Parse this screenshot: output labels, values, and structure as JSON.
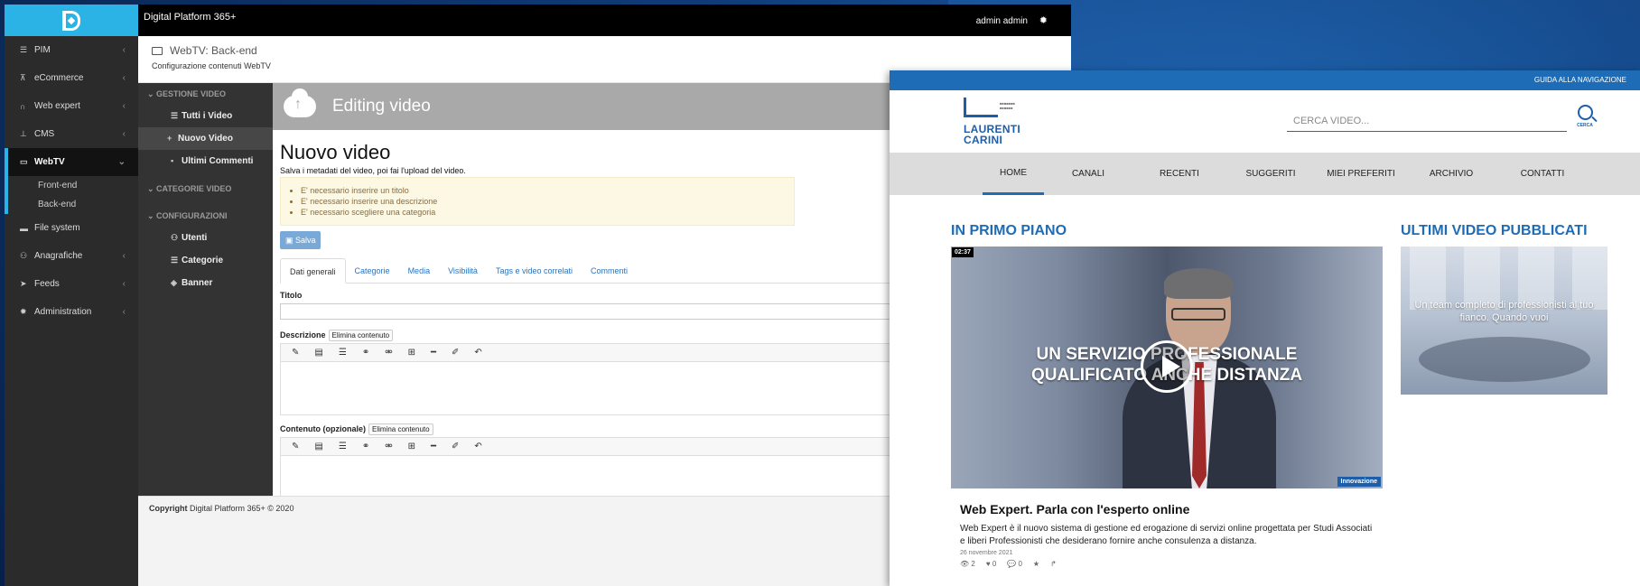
{
  "admin": {
    "app_title": "Digital Platform 365+",
    "user": "admin admin",
    "sidebar": [
      {
        "icon": "list-icon",
        "label": "PIM"
      },
      {
        "icon": "cart-icon",
        "label": "eCommerce"
      },
      {
        "icon": "headset-icon",
        "label": "Web expert"
      },
      {
        "icon": "sitemap-icon",
        "label": "CMS"
      },
      {
        "icon": "monitor-icon",
        "label": "WebTV"
      },
      {
        "icon": "folder-icon",
        "label": "File system"
      },
      {
        "icon": "users-icon",
        "label": "Anagrafiche"
      },
      {
        "icon": "paper-plane-icon",
        "label": "Feeds"
      },
      {
        "icon": "gear-icon",
        "label": "Administration"
      }
    ],
    "webtv_sub": [
      "Front-end",
      "Back-end"
    ],
    "header_title": "WebTV: Back-end",
    "header_sub": "Configurazione contenuti WebTV",
    "sub_menu": {
      "group1": "GESTIONE VIDEO",
      "links1": [
        "Tutti i Video",
        "Nuovo Video",
        "Ultimi Commenti"
      ],
      "group2": "CATEGORIE VIDEO",
      "group3": "CONFIGURAZIONI",
      "links3": [
        "Utenti",
        "Categorie",
        "Banner"
      ]
    },
    "editing_title": "Editing video",
    "page_title": "Nuovo video",
    "hint": "Salva i metadati del video, poi fai l'upload del video.",
    "alerts": [
      "E' necessario inserire un titolo",
      "E' necessario inserire una descrizione",
      "E' necessario scegliere una categoria"
    ],
    "save_label": "Salva",
    "tabs": [
      "Dati generali",
      "Categorie",
      "Media",
      "Visibilità",
      "Tags e video correlati",
      "Commenti"
    ],
    "field_title": "Titolo",
    "field_desc": "Descrizione",
    "field_content": "Contenuto (opzionale)",
    "clear_label": "Elimina contenuto",
    "footer_bold": "Copyright",
    "footer_text": " Digital Platform 365+ © 2020"
  },
  "webtv": {
    "top_link": "GUIDA ALLA NAVIGAZIONE",
    "logo_line1": "LAURENTI",
    "logo_line2": "CARINI",
    "search_placeholder": "CERCA VIDEO...",
    "search_btn": "CERCA",
    "nav": [
      "HOME",
      "CANALI",
      "RECENTI",
      "SUGGERITI",
      "MIEI PREFERITI",
      "ARCHIVIO",
      "CONTATTI"
    ],
    "featured_title": "IN PRIMO PIANO",
    "latest_title": "ULTIMI VIDEO PUBBLICATI",
    "hero": {
      "duration": "02:37",
      "line1": "UN SERVIZIO PROFESSIONALE",
      "line2": "QUALIFICATO ANCHE DISTANZA",
      "badge": "Innovazione"
    },
    "article": {
      "title": "Web Expert. Parla con l'esperto online",
      "desc": "Web Expert è il nuovo sistema di gestione ed erogazione di servizi online progettata per Studi Associati e liberi Professionisti che desiderano fornire anche consulenza a distanza.",
      "date": "26 novembre 2021",
      "views": "2",
      "likes": "0",
      "comments": "0"
    },
    "thumb_caption": "Un team completo di professionisti al tuo fianco. Quando vuoi"
  }
}
